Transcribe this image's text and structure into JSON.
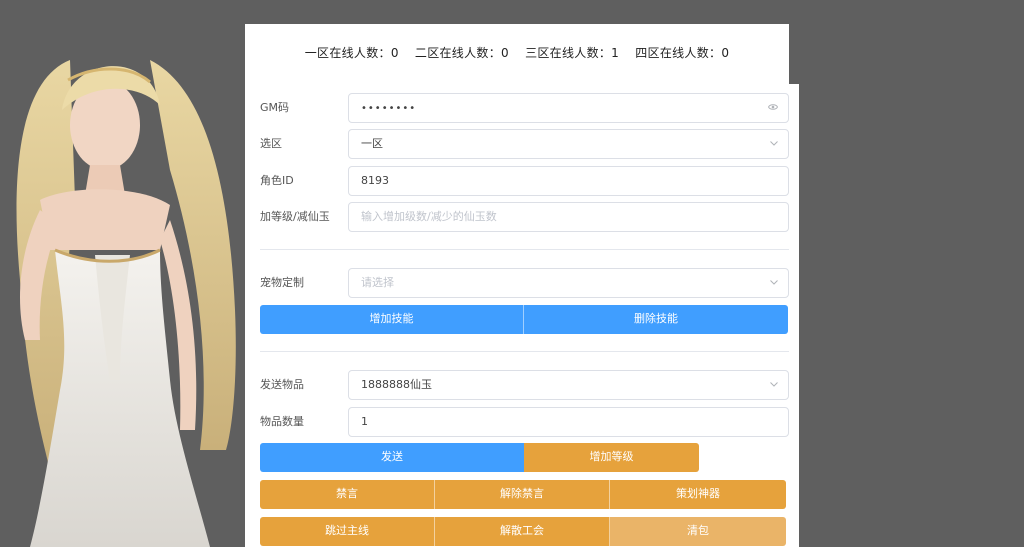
{
  "online": {
    "zone1": "一区在线人数：0",
    "zone2": "二区在线人数：0",
    "zone3": "三区在线人数：1",
    "zone4": "四区在线人数：0"
  },
  "form": {
    "gm_code": {
      "label": "GM码",
      "value": "••••••••",
      "icon": "eye-icon"
    },
    "zone": {
      "label": "选区",
      "value": "一区",
      "icon": "chevron-down-icon"
    },
    "role_id": {
      "label": "角色ID",
      "value": "8193"
    },
    "level_jade": {
      "label": "加等级/减仙玉",
      "placeholder": "输入增加级数/减少的仙玉数"
    },
    "pet": {
      "label": "宠物定制",
      "placeholder": "请选择",
      "icon": "chevron-down-icon"
    },
    "send_item": {
      "label": "发送物品",
      "value": "1888888仙玉",
      "icon": "chevron-down-icon"
    },
    "item_qty": {
      "label": "物品数量",
      "value": "1"
    }
  },
  "buttons": {
    "add_skill": "增加技能",
    "delete_skill": "删除技能",
    "send": "发送",
    "add_level": "增加等级",
    "mute": "禁言",
    "unmute": "解除禁言",
    "plan_artifact": "策划神器",
    "skip_main": "跳过主线",
    "disband_guild": "解散工会",
    "clear_bag": "清包"
  },
  "colors": {
    "blue": "#409eff",
    "orange": "#e6a23c",
    "background": "#5f5f5f"
  }
}
